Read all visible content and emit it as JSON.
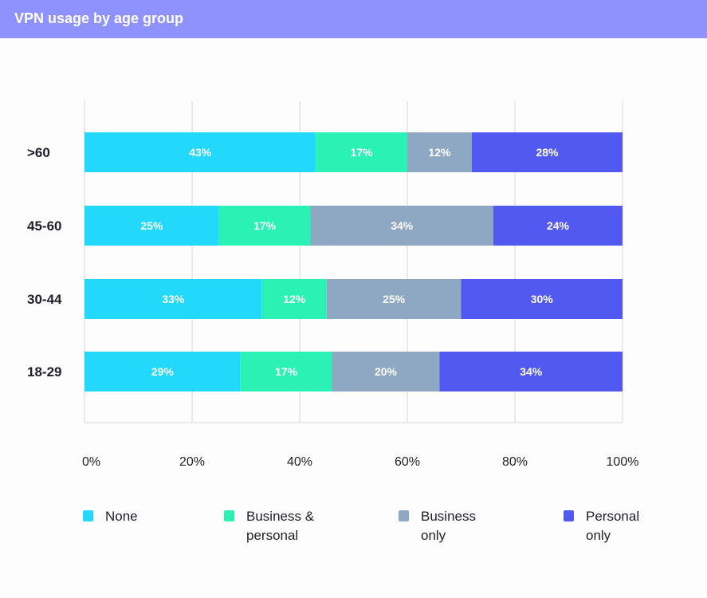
{
  "header": {
    "title": "VPN usage by age group"
  },
  "chart_data": {
    "type": "bar",
    "orientation": "horizontal",
    "stacked": true,
    "title": "VPN usage by age group",
    "xlabel": "",
    "ylabel": "",
    "xlim": [
      0,
      100
    ],
    "x_ticks": [
      "0%",
      "20%",
      "40%",
      "60%",
      "80%",
      "100%"
    ],
    "grid": true,
    "legend_position": "bottom",
    "categories": [
      ">60",
      "45-60",
      "30-44",
      "18-29"
    ],
    "series": [
      {
        "name": "None",
        "color": "#22d8fb",
        "values": [
          43,
          25,
          33,
          29
        ]
      },
      {
        "name": "Business & personal",
        "color": "#2af2b5",
        "values": [
          17,
          17,
          12,
          17
        ]
      },
      {
        "name": "Business only",
        "color": "#8ea8c4",
        "values": [
          12,
          34,
          25,
          20
        ]
      },
      {
        "name": "Personal only",
        "color": "#5159f0",
        "values": [
          28,
          24,
          30,
          34
        ]
      }
    ],
    "legend": [
      {
        "lines": [
          "None"
        ]
      },
      {
        "lines": [
          "Business &",
          "personal"
        ]
      },
      {
        "lines": [
          "Business",
          "only"
        ]
      },
      {
        "lines": [
          "Personal",
          "only"
        ]
      }
    ]
  }
}
